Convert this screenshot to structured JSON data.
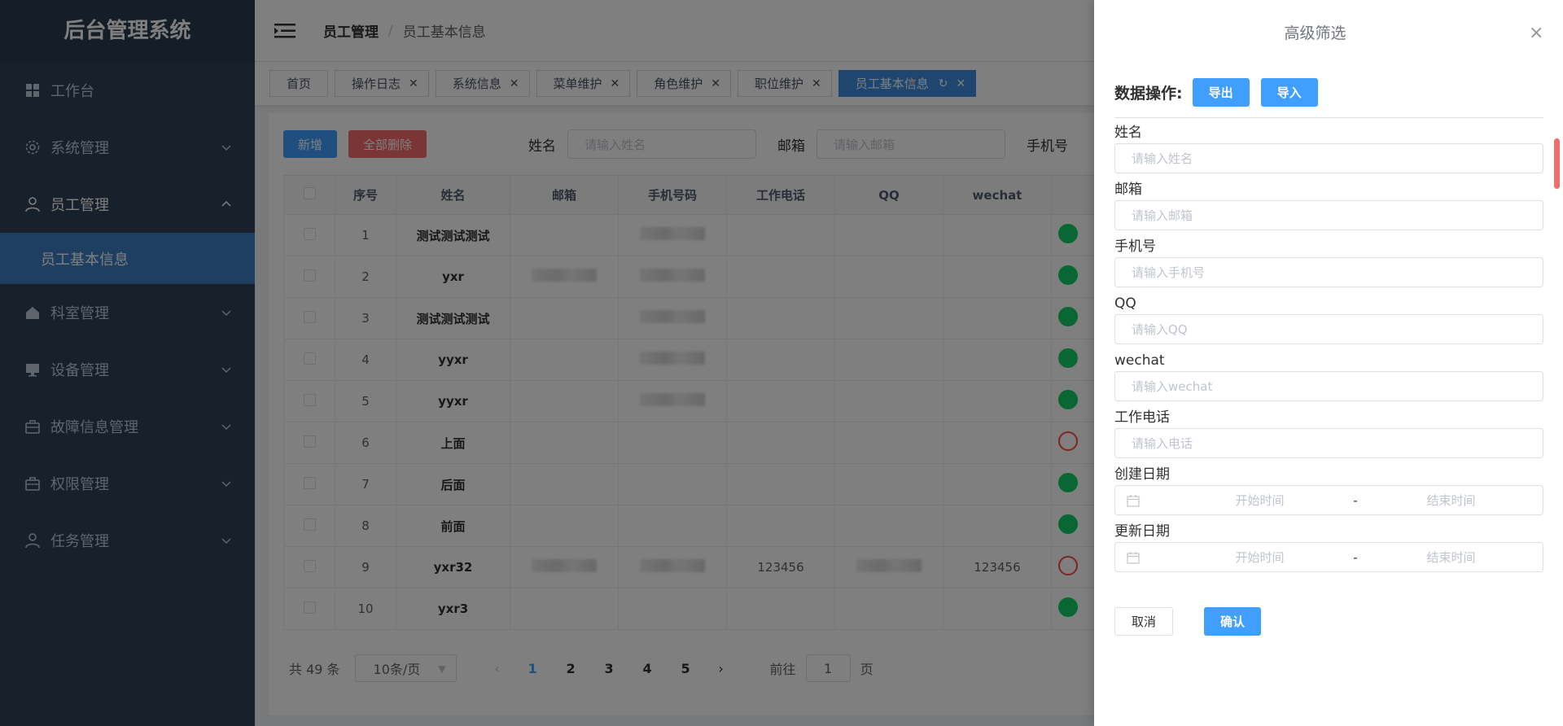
{
  "app": {
    "title": "后台管理系统"
  },
  "sidebar": {
    "items": [
      {
        "label": "工作台",
        "icon": "dashboard-icon",
        "has_arrow": false
      },
      {
        "label": "系统管理",
        "icon": "gear-icon",
        "has_arrow": true
      },
      {
        "label": "员工管理",
        "icon": "user-icon",
        "has_arrow": true,
        "open": true
      },
      {
        "label": "员工基本信息",
        "sub": true,
        "active": true
      },
      {
        "label": "科室管理",
        "icon": "home-icon",
        "has_arrow": true
      },
      {
        "label": "设备管理",
        "icon": "monitor-icon",
        "has_arrow": true
      },
      {
        "label": "故障信息管理",
        "icon": "briefcase-icon",
        "has_arrow": true
      },
      {
        "label": "权限管理",
        "icon": "briefcase-icon",
        "has_arrow": true
      },
      {
        "label": "任务管理",
        "icon": "user-icon",
        "has_arrow": true
      }
    ]
  },
  "breadcrumb": {
    "level1": "员工管理",
    "separator": "/",
    "level2": "员工基本信息"
  },
  "tags": [
    "首页",
    "操作日志",
    "系统信息",
    "菜单维护",
    "角色维护",
    "职位维护",
    "员工基本信息"
  ],
  "toolbar": {
    "add_label": "新增",
    "delete_all_label": "全部删除",
    "name_label": "姓名",
    "name_placeholder": "请输入姓名",
    "email_label": "邮箱",
    "email_placeholder": "请输入邮箱",
    "phone_label": "手机号"
  },
  "table": {
    "headers": [
      "",
      "序号",
      "姓名",
      "邮箱",
      "手机号码",
      "工作电话",
      "QQ",
      "wechat",
      ""
    ],
    "rows": [
      {
        "no": "1",
        "name": "测试测试测试",
        "email": "",
        "phone": "blur",
        "work": "",
        "qq": "",
        "wechat": "",
        "status": "on"
      },
      {
        "no": "2",
        "name": "yxr",
        "email": "blur",
        "phone": "blur",
        "work": "",
        "qq": "",
        "wechat": "",
        "status": "on"
      },
      {
        "no": "3",
        "name": "测试测试测试",
        "email": "",
        "phone": "blur",
        "work": "",
        "qq": "",
        "wechat": "",
        "status": "on"
      },
      {
        "no": "4",
        "name": "yyxr",
        "email": "",
        "phone": "blur",
        "work": "",
        "qq": "",
        "wechat": "",
        "status": "on"
      },
      {
        "no": "5",
        "name": "yyxr",
        "email": "",
        "phone": "blur",
        "work": "",
        "qq": "",
        "wechat": "",
        "status": "on"
      },
      {
        "no": "6",
        "name": "上面",
        "email": "",
        "phone": "",
        "work": "",
        "qq": "",
        "wechat": "",
        "status": "off"
      },
      {
        "no": "7",
        "name": "后面",
        "email": "",
        "phone": "",
        "work": "",
        "qq": "",
        "wechat": "",
        "status": "on"
      },
      {
        "no": "8",
        "name": "前面",
        "email": "",
        "phone": "",
        "work": "",
        "qq": "",
        "wechat": "",
        "status": "on"
      },
      {
        "no": "9",
        "name": "yxr32",
        "email": "blur",
        "phone": "blur",
        "work": "123456",
        "qq": "blur",
        "wechat": "123456",
        "status": "off"
      },
      {
        "no": "10",
        "name": "yxr3",
        "email": "",
        "phone": "",
        "work": "",
        "qq": "",
        "wechat": "",
        "status": "on"
      }
    ]
  },
  "pager": {
    "total_text": "共 49 条",
    "page_size": "10条/页",
    "pages": [
      "1",
      "2",
      "3",
      "4",
      "5"
    ],
    "current": "1",
    "goto_label": "前往",
    "goto_value": "1",
    "page_suffix": "页"
  },
  "drawer": {
    "title": "高级筛选",
    "ops_label": "数据操作:",
    "export_label": "导出",
    "import_label": "导入",
    "fields": [
      {
        "label": "姓名",
        "placeholder": "请输入姓名"
      },
      {
        "label": "邮箱",
        "placeholder": "请输入邮箱"
      },
      {
        "label": "手机号",
        "placeholder": "请输入手机号"
      },
      {
        "label": "QQ",
        "placeholder": "请输入QQ"
      },
      {
        "label": "wechat",
        "placeholder": "请输入wechat"
      },
      {
        "label": "工作电话",
        "placeholder": "请输入电话"
      }
    ],
    "ranges": [
      {
        "label": "创建日期",
        "start": "开始时间",
        "dash": "-",
        "end": "结束时间"
      },
      {
        "label": "更新日期",
        "start": "开始时间",
        "dash": "-",
        "end": "结束时间"
      }
    ],
    "cancel_label": "取消",
    "confirm_label": "确认"
  },
  "colors": {
    "primary": "#409eff",
    "danger": "#f56c6c",
    "sidebar": "#304156",
    "active_menu": "#3c7fc5",
    "success": "#13ce66"
  }
}
